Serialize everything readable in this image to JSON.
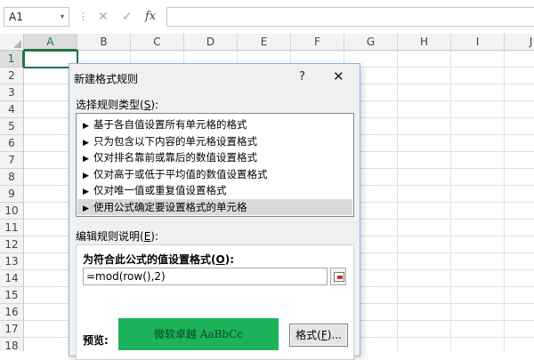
{
  "formula_bar": {
    "name_box": "A1",
    "name_box_dropdown": "▾",
    "separator": "⋮",
    "cancel_icon": "✕",
    "enter_icon": "✓",
    "fx_label": "fx",
    "formula": ""
  },
  "grid": {
    "columns": [
      "A",
      "B",
      "C",
      "D",
      "E",
      "F",
      "G",
      "H",
      "I",
      "J"
    ],
    "rows": [
      "1",
      "2",
      "3",
      "4",
      "5",
      "6",
      "7",
      "8",
      "9",
      "10",
      "11",
      "12",
      "13",
      "14",
      "15",
      "16",
      "17",
      "18",
      "19"
    ],
    "active_cell": "A1",
    "accent_color": "#217346"
  },
  "dialog": {
    "title": "新建格式规则",
    "help": "?",
    "close": "✕",
    "section_type_label": "选择规则类型(",
    "section_type_key": "S",
    "section_type_end": "):",
    "rule_types": [
      {
        "label": "基于各自值设置所有单元格的格式",
        "selected": false
      },
      {
        "label": "只为包含以下内容的单元格设置格式",
        "selected": false
      },
      {
        "label": "仅对排名靠前或靠后的数值设置格式",
        "selected": false
      },
      {
        "label": "仅对高于或低于平均值的数值设置格式",
        "selected": false
      },
      {
        "label": "仅对唯一值或重复值设置格式",
        "selected": false
      },
      {
        "label": "使用公式确定要设置格式的单元格",
        "selected": true
      }
    ],
    "rule_arrow": "▶",
    "section_desc_label": "编辑规则说明(",
    "section_desc_key": "E",
    "section_desc_end": "):",
    "formula_label": "为符合此公式的值设置格式(",
    "formula_key": "O",
    "formula_end": "):",
    "formula_value": "=mod(row(),2)",
    "preview_label": "预览:",
    "preview_text": "微软卓越  AaBbCc",
    "preview_color": "#1bb25a",
    "format_button_label": "格式(",
    "format_button_key": "F",
    "format_button_end": ")..."
  }
}
